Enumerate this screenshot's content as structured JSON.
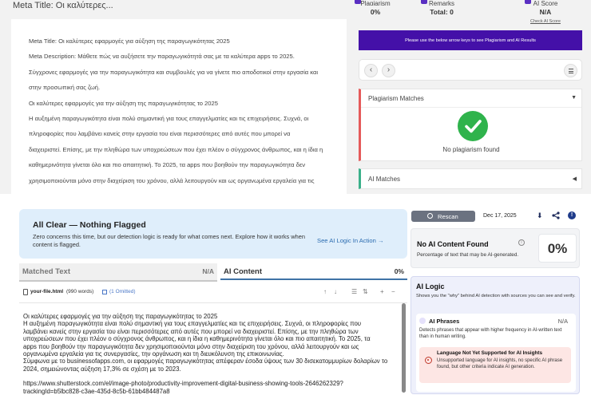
{
  "top": {
    "meta_title_header": "Meta Title: Οι καλύτερες...",
    "editor_lines": [
      "Meta Title: Οι καλύτερες εφαρμογές για αύξηση της παραγωγικότητας 2025",
      "Meta Description: Μάθετε πώς να αυξήσετε την παραγωγικότητά σας με τα καλύτερα apps το 2025.",
      "Σύγχρονες εφαρμογές για την παραγωγικότητα και συμβουλές για να γίνετε πιο αποδοτικοί στην εργασία και",
      "στην προσωπική σας ζωή.",
      "Οι καλύτερες εφαρμογές για την αύξηση της παραγωγικότητας το 2025",
      "Η αυξημένη παραγωγικότητα είναι πολύ σημαντική για τους επαγγελματίες και τις επιχειρήσεις. Συχνά, οι",
      "πληροφορίες που λαμβάνει κανείς στην εργασία του είναι περισσότερες από αυτές που μπορεί να",
      "διαχειριστεί. Επίσης, με την πληθώρα των υποχρεώσεων που έχει πλέον ο σύγχρονος άνθρωπος, και η ίδια η",
      "καθημερινότητα γίνεται όλο και πιο απαιτητική. Το 2025, τα apps που βοηθούν την παραγωγικότητα δεν",
      "χρησιμοποιούνται μόνο στην διαχείριση του χρόνου, αλλά λειτουργούν και ως οργανωμένα εργαλεία για τις"
    ],
    "stats": [
      {
        "label": "Plagiarism",
        "value": "0%"
      },
      {
        "label": "Remarks",
        "value": "Total: 0"
      },
      {
        "label": "AI Score",
        "value": "N/A"
      }
    ],
    "check_ai_score": "Check AI Score",
    "banner_text": "Please use the below arrow keys to see Plagiarism and AI Results",
    "nav": {
      "prev": "‹",
      "next": "›"
    },
    "plagiarism_matches": "Plagiarism Matches",
    "no_plagiarism": "No plagiarism found",
    "ai_matches": "AI Matches"
  },
  "bottom": {
    "all_clear_title": "All Clear — Nothing Flagged",
    "all_clear_desc": "Zero concerns this time, but our detection logic is ready for what comes next. Explore how it works when content is flagged.",
    "all_clear_link": "See AI Logic In Action →",
    "tabs": [
      {
        "label": "Matched Text",
        "value": "N/A"
      },
      {
        "label": "AI Content",
        "value": "0%"
      }
    ],
    "file": {
      "name": "your-file.html",
      "words": "(990 words)",
      "omitted": "(1 Omitted)"
    },
    "controls": [
      "↑",
      "↓",
      "☰",
      "⇅",
      "+",
      "−"
    ],
    "doc_lines": [
      "Οι καλύτερες εφαρμογές για την αύξηση της παραγωγικότητας το 2025",
      "Η αυξημένη παραγωγικότητα είναι πολύ σημαντική για τους επαγγελματίες και τις επιχειρήσεις. Συχνά, οι πληροφορίες που",
      "λαμβάνει κανείς στην εργασία του είναι περισσότερες από αυτές που μπορεί να διαχειριστεί. Επίσης, με την πληθώρα των",
      "υποχρεώσεων που έχει πλέον ο σύγχρονος άνθρωπος, και η ίδια η καθημερινότητα γίνεται όλο και πιο απαιτητική. Το 2025, τα",
      "apps που βοηθούν την παραγωγικότητα δεν χρησιμοποιούνται μόνο στην διαχείριση του χρόνου, αλλά λειτουργούν και ως",
      "οργανωμένα εργαλεία για τις συνεργασίες, την οργάνωση και τη διευκόλυνση της επικοινωνίας.",
      "Σύμφωνα με το businessofapps.com, οι εφαρμογές παραγωγικότητας απέφεραν έσοδα ύψους των 30 δισεκατομμυρίων δολαρίων το",
      "2024, σημειώνοντας αύξηση 17,3% σε σχέση με το 2023."
    ],
    "doc_link_lines": [
      "https://www.shutterstock.com/el/image-photo/productivity-improvement-digital-business-showing-tools-2646262329?",
      "trackingId=b5lbc828-c3ae-435d-8c5b-61bb484487a8"
    ],
    "rescan": "Rescan",
    "date": "Dec 17, 2025",
    "no_ai_title": "No AI Content Found",
    "no_ai_desc": "Percentage of text that may be AI-generated.",
    "no_ai_pct": "0%",
    "ai_logic_title": "AI Logic",
    "ai_logic_desc": "Shows you the \"why\" behind AI detection with sources you can see and verify.",
    "ai_phrases_title": "AI Phrases",
    "ai_phrases_value": "N/A",
    "ai_phrases_desc": "Detects phrases that appear with higher frequency in AI-written text than in human writing.",
    "warn_title": "Language Not Yet Supported for AI Insights",
    "warn_desc": "Unsupported language for AI insights, no specific AI phrase found, but other criteria indicate AI generation."
  },
  "colors": {
    "purple_banner": "#4410a8",
    "check_green": "#2fb34c",
    "plag_border": "#e55a5a",
    "ai_border": "#3bb08a",
    "link_blue": "#2b6cb0"
  }
}
